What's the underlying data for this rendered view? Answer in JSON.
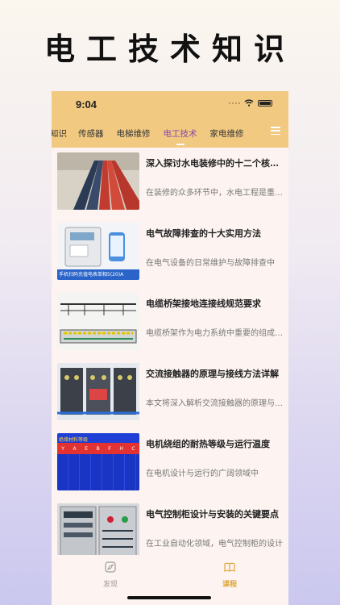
{
  "promo": {
    "title": "电工技术知识"
  },
  "status": {
    "time": "9:04"
  },
  "tabs": [
    "知识",
    "传感器",
    "电梯维修",
    "电工技术",
    "家电维修"
  ],
  "active_tab": "电工技术",
  "articles": [
    {
      "title": "深入探讨水电装修中的十二个核心要点",
      "desc": "在装修的众多环节中，水电工程是重中之重",
      "thumb_icon": "cable-trays-photo"
    },
    {
      "title": "电气故障排查的十大实用方法",
      "desc": "在电气设备的日常维护与故障排查中",
      "thumb_icon": "prepaid-meter-photo",
      "thumb_caption": "手机扫码充值电表单相5(20)A"
    },
    {
      "title": "电缆桥架接地连接线规范要求",
      "desc": "电缆桥架作为电力系统中重要的组成部分",
      "thumb_icon": "cable-tray-diagram"
    },
    {
      "title": "交流接触器的原理与接线方法详解",
      "desc": "本文将深入解析交流接触器的原理与接线",
      "thumb_icon": "contactor-photo"
    },
    {
      "title": "电机绕组的耐热等级与运行温度",
      "desc": "在电机设计与运行的广阔领域中",
      "thumb_icon": "insulation-class-table",
      "thumb_header": "绝缘材料等级",
      "thumb_classes": [
        "Y",
        "A",
        "E",
        "B",
        "F",
        "H",
        "C"
      ]
    },
    {
      "title": "电气控制柜设计与安装的关键要点",
      "desc": "在工业自动化领域，电气控制柜的设计",
      "thumb_icon": "control-cabinet-photo"
    }
  ],
  "tabbar": {
    "discover_label": "发现",
    "course_label": "课程",
    "active_color": "#e0a53c",
    "inactive_color": "#9a9a9a"
  }
}
